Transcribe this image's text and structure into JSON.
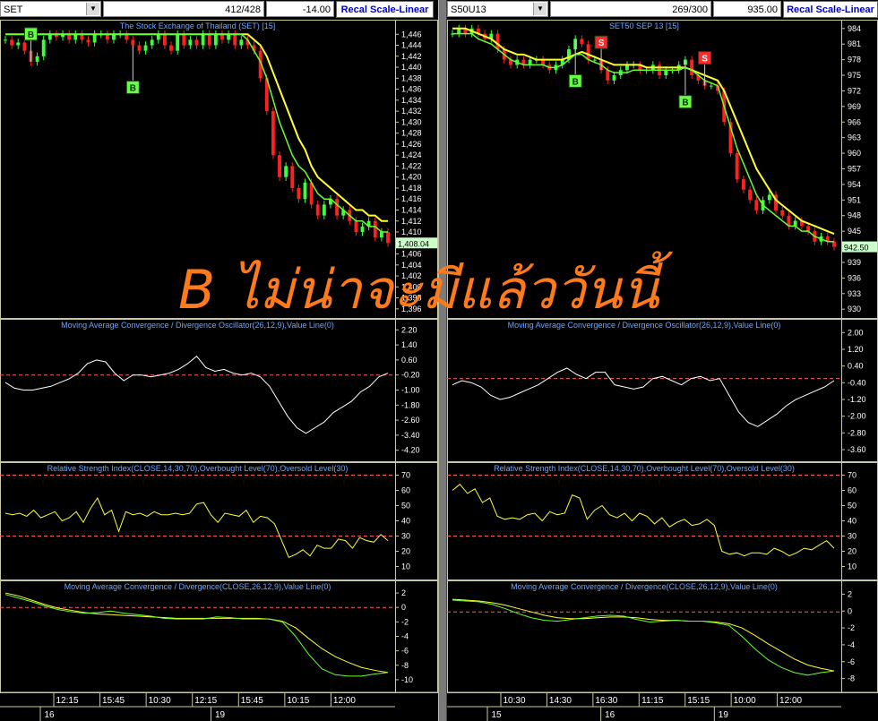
{
  "colors": {
    "up": "#3cff3c",
    "down": "#ff2020",
    "ema_yellow": "#ffff33",
    "ema_green": "#66ff33",
    "macd_line": "#ffffff",
    "ref_line": "#ff5a5a",
    "title": "#6aa6ff",
    "overlay": "#ff7a1a",
    "buy_badge": "#66ff44",
    "sell_badge": "#ff2a2a"
  },
  "overlay_text": "B ไม่น่าจะมีแล้ววันนี้",
  "icons": {
    "dropdown": "chevron-down-icon"
  },
  "panels": [
    {
      "symbol": "SET",
      "counter": "412/428",
      "change": "-14.00",
      "recal_label": "Recal Scale-Linear",
      "price": {
        "title": "The Stock Exchange of Thailand (SET) [15]",
        "ticks": [
          "1,446",
          "1,444",
          "1,442",
          "1,440",
          "1,438",
          "1,436",
          "1,434",
          "1,432",
          "1,430",
          "1,428",
          "1,426",
          "1,424",
          "1,422",
          "1,420",
          "1,418",
          "1,416",
          "1,414",
          "1,412",
          "1,410",
          "1,406",
          "1,404",
          "1,402",
          "1,400",
          "1,398",
          "1,396"
        ],
        "last_price": "1,408.04",
        "ylim": [
          1395,
          1448
        ],
        "closes": [
          1445,
          1444,
          1444.5,
          1443,
          1441,
          1442,
          1445,
          1446,
          1445.5,
          1446,
          1445,
          1446,
          1445,
          1444.5,
          1446,
          1446,
          1445,
          1446,
          1446,
          1445,
          1444,
          1443,
          1444,
          1445,
          1446,
          1444,
          1443,
          1446,
          1444,
          1445,
          1444,
          1446,
          1444,
          1446,
          1445,
          1446,
          1444,
          1445,
          1444,
          1443,
          1438,
          1432,
          1424,
          1420,
          1422,
          1418,
          1416,
          1419,
          1415,
          1413,
          1415,
          1416,
          1413,
          1414,
          1412,
          1410,
          1411,
          1412,
          1409,
          1410,
          1408
        ],
        "ema_yellow_levels": [
          1446,
          1446,
          1446,
          1446,
          1446,
          1446,
          1446,
          1446,
          1446,
          1446,
          1446,
          1446,
          1446,
          1446,
          1446,
          1446,
          1446,
          1446,
          1446,
          1446,
          1446,
          1446,
          1446,
          1446,
          1446,
          1446,
          1446,
          1446,
          1446,
          1446,
          1446,
          1446,
          1446,
          1446,
          1446,
          1446,
          1446,
          1446,
          1446,
          1445,
          1444,
          1442,
          1439,
          1436,
          1433,
          1430,
          1427,
          1425,
          1422,
          1420,
          1419,
          1418,
          1417,
          1416,
          1415,
          1414,
          1414,
          1413,
          1413,
          1412,
          1412
        ],
        "ema_green_levels": [
          1446,
          1446,
          1446,
          1446,
          1446,
          1446,
          1446,
          1446,
          1446,
          1446,
          1446,
          1446,
          1446,
          1446,
          1446,
          1446,
          1446,
          1446,
          1446,
          1446,
          1446,
          1446,
          1446,
          1446,
          1446,
          1446,
          1446,
          1446,
          1446,
          1446,
          1446,
          1446,
          1446,
          1446,
          1446,
          1446,
          1446,
          1446,
          1445,
          1443,
          1441,
          1438,
          1434,
          1430,
          1427,
          1424,
          1422,
          1421,
          1419,
          1417,
          1416,
          1416,
          1415,
          1414,
          1413,
          1412,
          1412,
          1411,
          1411,
          1410,
          1410
        ],
        "signals": [
          {
            "type": "B",
            "bar": 4,
            "below": false
          },
          {
            "type": "B",
            "bar": 20,
            "below": true
          }
        ]
      },
      "macd_hist": {
        "title": "Moving Average Convergence / Divergence Oscillator(26,12,9),Value Line(0)",
        "ticks": [
          "2.20",
          "1.40",
          "0.60",
          "-0.20",
          "-1.00",
          "-1.80",
          "-2.60",
          "-3.40",
          "-4.20"
        ],
        "ylim": [
          -4.5,
          2.5
        ],
        "ref": -0.2,
        "values": [
          -0.6,
          -0.9,
          -1.0,
          -1.0,
          -0.9,
          -0.8,
          -0.6,
          -0.4,
          -0.1,
          0.4,
          0.6,
          0.5,
          -0.1,
          -0.5,
          -0.2,
          -0.2,
          -0.3,
          -0.2,
          -0.1,
          0.1,
          0.4,
          0.8,
          0.2,
          0.0,
          0.1,
          -0.1,
          -0.2,
          -0.1,
          -0.3,
          -0.8,
          -1.6,
          -2.4,
          -3.0,
          -3.3,
          -3.0,
          -2.7,
          -2.2,
          -1.9,
          -1.6,
          -1.1,
          -0.8,
          -0.3,
          -0.1
        ]
      },
      "rsi": {
        "title": "Relative Strength Index(CLOSE,14,30,70),Overbought Level(70),Oversold Level(30)",
        "ticks": [
          "70",
          "60",
          "50",
          "40",
          "30",
          "20",
          "10"
        ],
        "ylim": [
          5,
          75
        ],
        "ref": [
          70,
          30
        ],
        "values": [
          45,
          44,
          45,
          43,
          47,
          42,
          44,
          46,
          40,
          42,
          46,
          39,
          48,
          55,
          44,
          47,
          33,
          46,
          44,
          45,
          43,
          46,
          44,
          44,
          45,
          44,
          45,
          51,
          52,
          44,
          39,
          45,
          44,
          43,
          47,
          39,
          43,
          42,
          38,
          27,
          16,
          18,
          21,
          17,
          24,
          22,
          22,
          28,
          27,
          22,
          29,
          27,
          26,
          31,
          27
        ]
      },
      "macd": {
        "title": "Moving Average Convergence / Divergence(CLOSE,26,12,9),Value Line(0)",
        "ticks": [
          "2",
          "0",
          "-2",
          "-4",
          "-6",
          "-8",
          "-10"
        ],
        "ylim": [
          -11,
          3
        ],
        "ref": 0,
        "macd_values": [
          1.8,
          1.3,
          0.8,
          0.2,
          -0.3,
          -0.6,
          -0.8,
          -0.7,
          -0.5,
          -0.8,
          -1.0,
          -1.2,
          -1.5,
          -1.6,
          -1.6,
          -1.6,
          -1.3,
          -1.4,
          -1.6,
          -1.6,
          -1.6,
          -2.0,
          -4.0,
          -6.5,
          -8.5,
          -9.3,
          -9.5,
          -9.5,
          -9.2,
          -9.0
        ],
        "signal_values": [
          2.0,
          1.6,
          1.0,
          0.4,
          -0.1,
          -0.4,
          -0.7,
          -0.9,
          -1.0,
          -1.1,
          -1.2,
          -1.3,
          -1.4,
          -1.5,
          -1.5,
          -1.5,
          -1.5,
          -1.5,
          -1.5,
          -1.5,
          -1.6,
          -1.9,
          -2.8,
          -4.3,
          -5.7,
          -6.8,
          -7.6,
          -8.3,
          -8.7,
          -9.0
        ]
      },
      "xaxis": {
        "times": [
          "12:15",
          "15:45",
          "10:30",
          "12:15",
          "15:45",
          "10:15",
          "12:00"
        ],
        "days": [
          "16",
          "19"
        ]
      }
    },
    {
      "symbol": "S50U13",
      "counter": "269/300",
      "change": "935.00",
      "recal_label": "Recal Scale-Linear",
      "price": {
        "title": "SET50 SEP 13   [15]",
        "ticks": [
          "984",
          "981",
          "978",
          "975",
          "972",
          "969",
          "966",
          "963",
          "960",
          "957",
          "954",
          "951",
          "948",
          "945",
          "942",
          "939",
          "936",
          "933",
          "930"
        ],
        "last_price": "942.50",
        "ylim": [
          929,
          985
        ],
        "closes": [
          983,
          984,
          983,
          984,
          983,
          982,
          983,
          980,
          978,
          977,
          978,
          977,
          978,
          978,
          977,
          976,
          977,
          978,
          980,
          982,
          981,
          978,
          978,
          976,
          974,
          975,
          976,
          977,
          977,
          976,
          976,
          977,
          975,
          976,
          976,
          977,
          978,
          975,
          974,
          973,
          973,
          972,
          966,
          960,
          955,
          953,
          951,
          949,
          951,
          952,
          949,
          948,
          946,
          947,
          946,
          945,
          943,
          944,
          943,
          942
        ],
        "ema_yellow_levels": [
          984,
          984,
          984,
          983.5,
          983,
          982.5,
          982,
          981,
          980,
          979.5,
          979,
          979,
          978.5,
          978,
          978,
          978,
          978,
          978,
          978.5,
          979,
          979.5,
          979,
          978.5,
          978,
          977.5,
          977,
          977,
          977,
          977,
          977,
          976.5,
          976.5,
          976.5,
          976.5,
          976.5,
          976.5,
          976.5,
          976,
          975.5,
          975,
          974.5,
          974,
          972,
          969,
          966,
          963,
          960,
          957,
          955,
          953,
          951,
          950,
          949,
          948,
          947,
          946.5,
          946,
          945.5,
          945,
          944.5
        ],
        "ema_green_levels": [
          983,
          983,
          983,
          983,
          982,
          981.5,
          981,
          980,
          979,
          978,
          977.5,
          977,
          977,
          977,
          977,
          976.5,
          976.5,
          977,
          978,
          979,
          979,
          978,
          977.5,
          977,
          976,
          975.5,
          975.5,
          975.5,
          976,
          976,
          976,
          976,
          976,
          976,
          976,
          976,
          976.5,
          976,
          975,
          974,
          973.5,
          973,
          969,
          965,
          961,
          958,
          955,
          952,
          950,
          949,
          948,
          947,
          946,
          946,
          945,
          945,
          944,
          943.5,
          943,
          943
        ],
        "signals": [
          {
            "type": "B",
            "bar": 19,
            "below": true
          },
          {
            "type": "S",
            "bar": 23,
            "below": false
          },
          {
            "type": "B",
            "bar": 36,
            "below": true
          },
          {
            "type": "S",
            "bar": 39,
            "below": false
          }
        ]
      },
      "macd_hist": {
        "title": "Moving Average Convergence / Divergence Oscillator(26,12,9),Value Line(0)",
        "ticks": [
          "2.00",
          "1.20",
          "0.40",
          "-0.40",
          "-1.20",
          "-2.00",
          "-2.80",
          "-3.60"
        ],
        "ylim": [
          -3.9,
          2.4
        ],
        "ref": -0.2,
        "values": [
          -0.5,
          -0.3,
          -0.4,
          -0.6,
          -1.0,
          -1.2,
          -1.1,
          -0.9,
          -0.7,
          -0.5,
          -0.2,
          0.1,
          0.3,
          0.0,
          -0.2,
          0.1,
          0.1,
          -0.5,
          -0.6,
          -0.7,
          -0.6,
          -0.2,
          -0.1,
          -0.3,
          -0.5,
          -0.2,
          -0.1,
          -0.3,
          -0.2,
          -1.0,
          -1.8,
          -2.3,
          -2.5,
          -2.2,
          -1.9,
          -1.5,
          -1.2,
          -1.0,
          -0.8,
          -0.6,
          -0.3
        ]
      },
      "rsi": {
        "title": "Relative Strength Index(CLOSE,14,30,70),Overbought Level(70),Oversold Level(30)",
        "ticks": [
          "70",
          "60",
          "50",
          "40",
          "30",
          "20",
          "10"
        ],
        "ylim": [
          5,
          75
        ],
        "ref": [
          70,
          30
        ],
        "values": [
          60,
          64,
          58,
          61,
          52,
          55,
          43,
          41,
          42,
          41,
          44,
          45,
          40,
          46,
          44,
          45,
          57,
          55,
          41,
          47,
          50,
          44,
          42,
          45,
          40,
          45,
          43,
          38,
          42,
          36,
          39,
          41,
          37,
          38,
          41,
          37,
          20,
          18,
          19,
          17,
          19,
          19,
          18,
          22,
          20,
          17,
          19,
          22,
          21,
          24,
          27,
          22
        ]
      },
      "macd": {
        "title": "Moving Average Convergence / Divergence(CLOSE,26,12,9),Value Line(0)",
        "ticks": [
          "2",
          "0",
          "-2",
          "-4",
          "-6",
          "-8"
        ],
        "ylim": [
          -9,
          3
        ],
        "ref": -0.1,
        "macd_values": [
          1.3,
          1.2,
          1.1,
          0.8,
          0.3,
          -0.3,
          -0.8,
          -1.1,
          -1.2,
          -1.0,
          -0.8,
          -0.6,
          -0.5,
          -0.6,
          -1.0,
          -1.3,
          -1.2,
          -1.1,
          -1.2,
          -1.2,
          -1.4,
          -1.7,
          -3.0,
          -4.5,
          -5.8,
          -6.7,
          -7.3,
          -7.6,
          -7.3,
          -7.1
        ],
        "signal_values": [
          1.4,
          1.3,
          1.2,
          1.0,
          0.7,
          0.3,
          -0.1,
          -0.5,
          -0.8,
          -0.9,
          -0.9,
          -0.8,
          -0.7,
          -0.7,
          -0.8,
          -1.0,
          -1.1,
          -1.1,
          -1.2,
          -1.2,
          -1.3,
          -1.5,
          -2.0,
          -2.9,
          -3.9,
          -4.8,
          -5.7,
          -6.4,
          -6.8,
          -7.1
        ]
      },
      "xaxis": {
        "times": [
          "10:30",
          "14:30",
          "16:30",
          "11:15",
          "15:15",
          "10:00",
          "12:00"
        ],
        "days": [
          "15",
          "16",
          "19"
        ]
      }
    }
  ]
}
